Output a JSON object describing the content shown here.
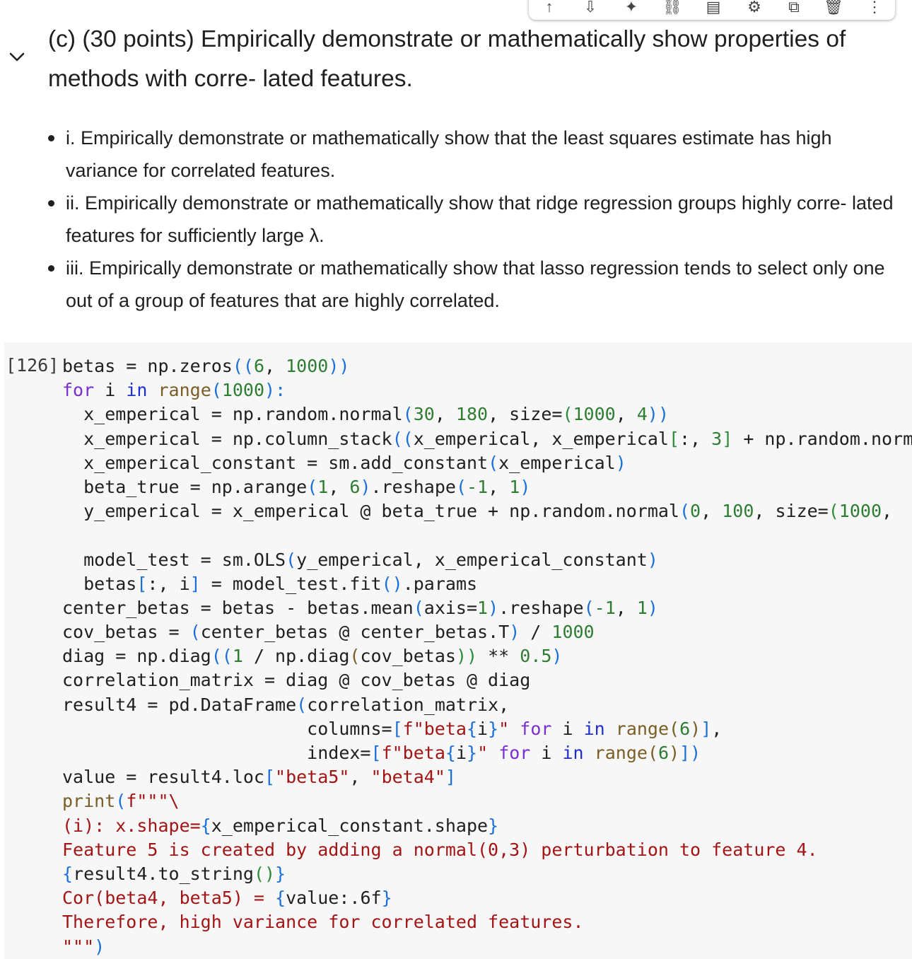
{
  "toolbar": {
    "buttons": [
      {
        "name": "move-up",
        "glyph": "↑"
      },
      {
        "name": "move-down",
        "glyph": "⇩"
      },
      {
        "name": "gemini",
        "glyph": "✦"
      },
      {
        "name": "link",
        "glyph": "⛓"
      },
      {
        "name": "comment",
        "glyph": "▤"
      },
      {
        "name": "settings",
        "glyph": "⚙"
      },
      {
        "name": "mirror",
        "glyph": "⧉"
      },
      {
        "name": "delete",
        "glyph": "🗑"
      },
      {
        "name": "more",
        "glyph": "⋮"
      }
    ]
  },
  "markdown": {
    "heading": "(c) (30 points) Empirically demonstrate or mathematically show properties of methods with corre- lated features.",
    "bullets": [
      "i. Empirically demonstrate or mathematically show that the least squares estimate has high variance for correlated features.",
      "ii. Empirically demonstrate or mathematically show that ridge regression groups highly corre- lated features for sufficiently large λ.",
      "iii. Empirically demonstrate or mathematically show that lasso regression tends to select only one out of a group of features that are highly correlated."
    ]
  },
  "cell": {
    "execution_count": "[126]",
    "code_lines": [
      [
        [
          "betas = np.zeros",
          "t"
        ],
        [
          "((",
          "pb"
        ],
        [
          "6",
          "num"
        ],
        [
          ", ",
          "t"
        ],
        [
          "1000",
          "num"
        ],
        [
          "))",
          "pb"
        ]
      ],
      [
        [
          "for",
          "kw"
        ],
        [
          " i ",
          "t"
        ],
        [
          "in",
          "kw2"
        ],
        [
          " ",
          "t"
        ],
        [
          "range",
          "fn"
        ],
        [
          "(",
          "pb"
        ],
        [
          "1000",
          "num"
        ],
        [
          "):",
          "pb"
        ]
      ],
      [
        [
          "  x_emperical = np.random.normal",
          "t"
        ],
        [
          "(",
          "pb"
        ],
        [
          "30",
          "num"
        ],
        [
          ", ",
          "t"
        ],
        [
          "180",
          "num"
        ],
        [
          ", size=",
          "t"
        ],
        [
          "(",
          "pg"
        ],
        [
          "1000",
          "num"
        ],
        [
          ", ",
          "t"
        ],
        [
          "4",
          "num"
        ],
        [
          "))",
          "pb"
        ]
      ],
      [
        [
          "  x_emperical = np.column_stack",
          "t"
        ],
        [
          "((",
          "pb"
        ],
        [
          "x_emperical, x_emperical",
          "t"
        ],
        [
          "[",
          "pg"
        ],
        [
          ":, ",
          "t"
        ],
        [
          "3",
          "num"
        ],
        [
          "]",
          "pg"
        ],
        [
          " + np.random.normal",
          "t"
        ]
      ],
      [
        [
          "  x_emperical_constant = sm.add_constant",
          "t"
        ],
        [
          "(",
          "pb"
        ],
        [
          "x_emperical",
          "t"
        ],
        [
          ")",
          "pb"
        ]
      ],
      [
        [
          "  beta_true = np.arange",
          "t"
        ],
        [
          "(",
          "pb"
        ],
        [
          "1",
          "num"
        ],
        [
          ", ",
          "t"
        ],
        [
          "6",
          "num"
        ],
        [
          ")",
          "pb"
        ],
        [
          ".reshape",
          "t"
        ],
        [
          "(",
          "pb"
        ],
        [
          "-1",
          "num"
        ],
        [
          ", ",
          "t"
        ],
        [
          "1",
          "num"
        ],
        [
          ")",
          "pb"
        ]
      ],
      [
        [
          "  y_emperical = x_emperical @ beta_true + np.random.normal",
          "t"
        ],
        [
          "(",
          "pb"
        ],
        [
          "0",
          "num"
        ],
        [
          ", ",
          "t"
        ],
        [
          "100",
          "num"
        ],
        [
          ", size=",
          "t"
        ],
        [
          "(",
          "pg"
        ],
        [
          "1000",
          "num"
        ],
        [
          ",",
          "t"
        ]
      ],
      [
        [
          "",
          "t"
        ]
      ],
      [
        [
          "  model_test = sm.OLS",
          "t"
        ],
        [
          "(",
          "pb"
        ],
        [
          "y_emperical, x_emperical_constant",
          "t"
        ],
        [
          ")",
          "pb"
        ]
      ],
      [
        [
          "  betas",
          "t"
        ],
        [
          "[",
          "pb"
        ],
        [
          ":, i",
          "t"
        ],
        [
          "]",
          "pb"
        ],
        [
          " = model_test.fit",
          "t"
        ],
        [
          "()",
          "pb"
        ],
        [
          ".params",
          "t"
        ]
      ],
      [
        [
          "center_betas = betas - betas.mean",
          "t"
        ],
        [
          "(",
          "pb"
        ],
        [
          "axis=",
          "t"
        ],
        [
          "1",
          "num"
        ],
        [
          ")",
          "pb"
        ],
        [
          ".reshape",
          "t"
        ],
        [
          "(",
          "pb"
        ],
        [
          "-1",
          "num"
        ],
        [
          ", ",
          "t"
        ],
        [
          "1",
          "num"
        ],
        [
          ")",
          "pb"
        ]
      ],
      [
        [
          "cov_betas = ",
          "t"
        ],
        [
          "(",
          "pb"
        ],
        [
          "center_betas @ center_betas.T",
          "t"
        ],
        [
          ")",
          "pb"
        ],
        [
          " / ",
          "t"
        ],
        [
          "1000",
          "num"
        ]
      ],
      [
        [
          "diag = np.diag",
          "t"
        ],
        [
          "((",
          "pb"
        ],
        [
          "1",
          "num"
        ],
        [
          " / np.diag",
          "t"
        ],
        [
          "(",
          "fn"
        ],
        [
          "cov_betas",
          "t"
        ],
        [
          "))",
          "pg"
        ],
        [
          " ** ",
          "t"
        ],
        [
          "0.5",
          "num"
        ],
        [
          ")",
          "pb"
        ]
      ],
      [
        [
          "correlation_matrix = diag @ cov_betas @ diag",
          "t"
        ]
      ],
      [
        [
          "result4 = pd.DataFrame",
          "t"
        ],
        [
          "(",
          "pb"
        ],
        [
          "correlation_matrix,",
          "t"
        ]
      ],
      [
        [
          "                       columns=",
          "t"
        ],
        [
          "[",
          "pb"
        ],
        [
          "f\"beta",
          "str"
        ],
        [
          "{",
          "pb"
        ],
        [
          "i",
          "t"
        ],
        [
          "}",
          "pb"
        ],
        [
          "\"",
          "str"
        ],
        [
          " ",
          "t"
        ],
        [
          "for",
          "kw"
        ],
        [
          " i ",
          "t"
        ],
        [
          "in",
          "kw2"
        ],
        [
          " ",
          "t"
        ],
        [
          "range",
          "fn"
        ],
        [
          "(",
          "fn"
        ],
        [
          "6",
          "num"
        ],
        [
          ")",
          "fn"
        ],
        [
          "]",
          "pb"
        ],
        [
          ",",
          "t"
        ]
      ],
      [
        [
          "                       index=",
          "t"
        ],
        [
          "[",
          "pb"
        ],
        [
          "f\"beta",
          "str"
        ],
        [
          "{",
          "pb"
        ],
        [
          "i",
          "t"
        ],
        [
          "}",
          "pb"
        ],
        [
          "\"",
          "str"
        ],
        [
          " ",
          "t"
        ],
        [
          "for",
          "kw"
        ],
        [
          " i ",
          "t"
        ],
        [
          "in",
          "kw2"
        ],
        [
          " ",
          "t"
        ],
        [
          "range",
          "fn"
        ],
        [
          "(",
          "fn"
        ],
        [
          "6",
          "num"
        ],
        [
          ")",
          "fn"
        ],
        [
          "])",
          "pb"
        ]
      ],
      [
        [
          "value = result4.loc",
          "t"
        ],
        [
          "[",
          "pb"
        ],
        [
          "\"beta5\"",
          "str"
        ],
        [
          ", ",
          "t"
        ],
        [
          "\"beta4\"",
          "str"
        ],
        [
          "]",
          "pb"
        ]
      ],
      [
        [
          "print",
          "fn"
        ],
        [
          "(",
          "pb"
        ],
        [
          "f\"\"\"\\",
          "str"
        ]
      ],
      [
        [
          "(i): x.shape=",
          "str"
        ],
        [
          "{",
          "pb"
        ],
        [
          "x_emperical_constant.shape",
          "t"
        ],
        [
          "}",
          "pb"
        ]
      ],
      [
        [
          "Feature 5 is created by adding a normal(0,3) perturbation to feature 4.",
          "str"
        ]
      ],
      [
        [
          "{",
          "pb"
        ],
        [
          "result4.to_string",
          "t"
        ],
        [
          "()",
          "pg"
        ],
        [
          "}",
          "pb"
        ]
      ],
      [
        [
          "Cor(beta4, beta5) = ",
          "str"
        ],
        [
          "{",
          "pb"
        ],
        [
          "value:.6f",
          "t"
        ],
        [
          "}",
          "pb"
        ]
      ],
      [
        [
          "Therefore, high variance for correlated features.",
          "str"
        ]
      ],
      [
        [
          "\"\"\"",
          "str"
        ],
        [
          ")",
          "pb"
        ]
      ]
    ]
  }
}
